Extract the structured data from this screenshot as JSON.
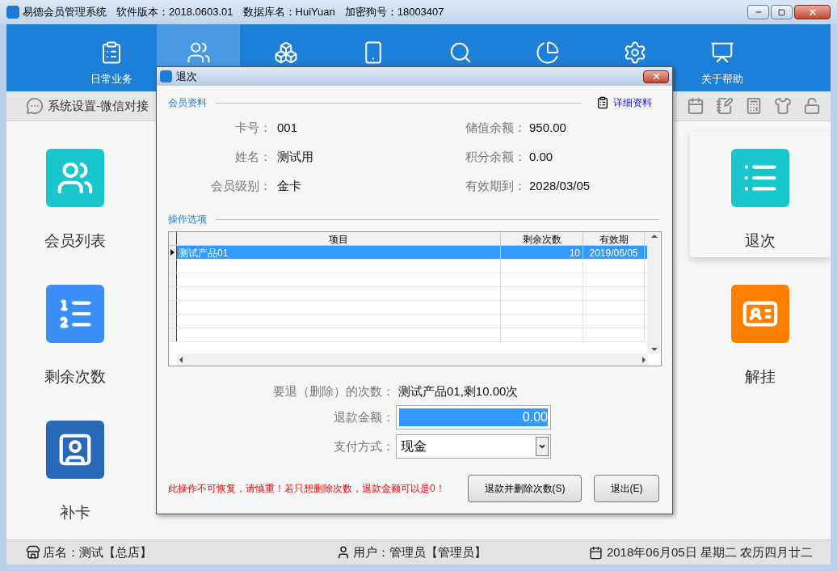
{
  "window": {
    "title": "易德会员管理系统",
    "version": "软件版本：2018.0603.01",
    "database": "数据库名：HuiYuan",
    "dongle": "加密狗号：18003407"
  },
  "nav": [
    {
      "label": "日常业务",
      "selected": false
    },
    {
      "selected": true
    },
    {
      "selected": false
    },
    {
      "selected": false
    },
    {
      "selected": false
    },
    {
      "selected": false
    },
    {
      "selected": false
    },
    {
      "label": "关于帮助",
      "selected": false
    }
  ],
  "toolbar": {
    "breadcrumb": "系统设置-微信对接"
  },
  "tiles_left": [
    {
      "label": "会员列表",
      "selected": false
    },
    {
      "label": "剩余次数",
      "selected": false
    },
    {
      "label": "补卡",
      "selected": false
    }
  ],
  "tiles_right": [
    {
      "label": "退次",
      "selected": true
    },
    {
      "label": "解挂",
      "selected": false
    }
  ],
  "dialog": {
    "title": "退次",
    "member_section": "会员资料",
    "detail_link": "详细资料",
    "fields_left": [
      {
        "label": "卡号：",
        "value": "001"
      },
      {
        "label": "姓名：",
        "value": "测试用"
      },
      {
        "label": "会员级别：",
        "value": "金卡"
      }
    ],
    "fields_right": [
      {
        "label": "储值余额：",
        "value": "950.00"
      },
      {
        "label": "积分余额：",
        "value": "0.00"
      },
      {
        "label": "有效期到：",
        "value": "2028/03/05"
      }
    ],
    "options_section": "操作选项",
    "table": {
      "columns": [
        "项目",
        "剩余次数",
        "有效期"
      ],
      "rows": [
        {
          "cells": [
            "测试产品01",
            "10",
            "2019/06/05"
          ],
          "selected": true
        }
      ]
    },
    "refund_count_label": "要退（删除）的次数：",
    "refund_count_value": "测试产品01,剩10.00次",
    "amount_label": "退款金额：",
    "amount_value": "0.00",
    "payment_label": "支付方式：",
    "payment_value": "现金",
    "warning": "此操作不可恢复，请慎重！若只想删除次数，退款金额可以是0！",
    "buttons": [
      "退款并删除次数(S)",
      "退出(E)"
    ]
  },
  "status_bar": {
    "store": "店名：测试【总店】",
    "user": "用户：管理员【管理员】",
    "date": "2018年06月05日 星期二 农历四月廿二"
  }
}
